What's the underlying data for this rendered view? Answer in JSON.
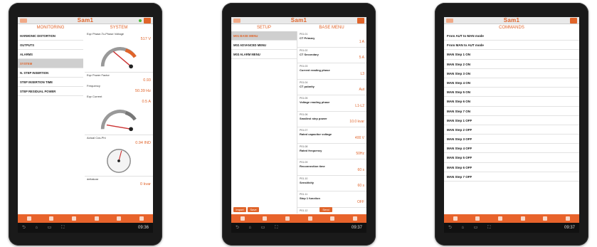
{
  "brand": {
    "logo": "Sam1",
    "accent": "#e0642a",
    "nav_bar": "#e8632b"
  },
  "tablet1": {
    "header_left": "MONITORING",
    "header_right": "SYSTEM",
    "menu": [
      "HARMONIC DISTORTION",
      "OUTPUTS",
      "ALARMS",
      "SYSTEM",
      "N. STEP INSERTION",
      "STEP INSERTION TIME",
      "STEP RESIDUAL POWER"
    ],
    "active_menu_index": 3,
    "readings": [
      {
        "label": "Eqv Phase-To-Phase Voltage",
        "value": "517 V"
      },
      {
        "label": "Eqv Power Factor",
        "value": "0.93"
      },
      {
        "label": "Frequency",
        "value": "50.39 Hz"
      },
      {
        "label": "Eqv Current",
        "value": "0.5 A"
      },
      {
        "label": "Actual Cos-Phi",
        "value": "0.94 IND"
      },
      {
        "label": "deltakvar",
        "value": "0 kvar"
      }
    ],
    "clock": "09:36"
  },
  "tablet2": {
    "header_left": "SETUP",
    "header_right": "BASE MENU",
    "menu": [
      "M01 BASE MENU",
      "M02 ADVANCED MENU",
      "M03 ALARM MENU"
    ],
    "active_menu_index": 0,
    "params": [
      {
        "code": "P01.01",
        "name": "CT Primary",
        "value": "1 A"
      },
      {
        "code": "P01.02",
        "name": "CT Secondary",
        "value": "5 A"
      },
      {
        "code": "P01.03",
        "name": "Current reading phase",
        "value": "L3"
      },
      {
        "code": "P01.04",
        "name": "CT polarity",
        "value": "Aut"
      },
      {
        "code": "P01.05",
        "name": "Voltage reading phase",
        "value": "L1-L2"
      },
      {
        "code": "P01.06",
        "name": "Smallest step power",
        "value": "10.0 kvar"
      },
      {
        "code": "P01.07",
        "name": "Rated capacitor voltage",
        "value": "400 V"
      },
      {
        "code": "P01.08",
        "name": "Rated frequency",
        "value": "50Hz"
      },
      {
        "code": "P01.09",
        "name": "Reconnection time",
        "value": "60 s"
      },
      {
        "code": "P01.10",
        "name": "Sensitivity",
        "value": "60 s"
      },
      {
        "code": "P01.11",
        "name": "Step 1 function",
        "value": "OFF"
      },
      {
        "code": "P01.12",
        "name": "",
        "value": ""
      }
    ],
    "btn_import": "Import",
    "btn_save": "Save",
    "btn_send": "Send",
    "clock": "09:37"
  },
  "tablet3": {
    "header": "COMMANDS",
    "commands": [
      "From AUT to MAN mode",
      "From MAN to AUT mode",
      "MAN Step 1 ON",
      "MAN Step 2 ON",
      "MAN Step 3 ON",
      "MAN Step 4 ON",
      "MAN Step 5 ON",
      "MAN Step 6 ON",
      "MAN Step 7 ON",
      "MAN Step 1 OFF",
      "MAN Step 2 OFF",
      "MAN Step 3 OFF",
      "MAN Step 4 OFF",
      "MAN Step 5 OFF",
      "MAN Step 6 OFF",
      "MAN Step 7 OFF"
    ],
    "clock": "09:37"
  }
}
